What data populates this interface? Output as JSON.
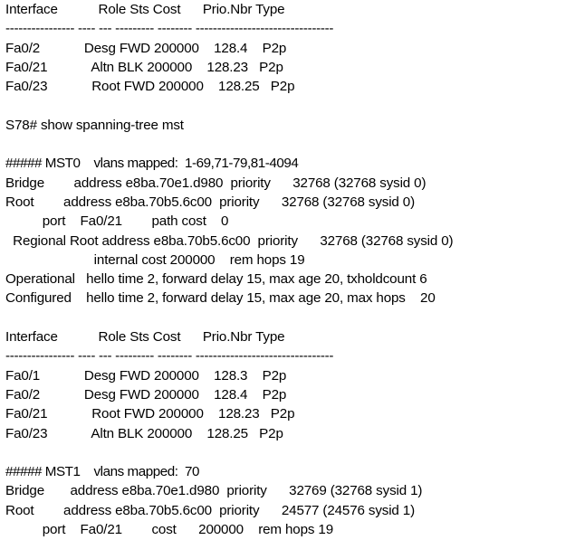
{
  "terminal": {
    "title": "Cisco IOS CLI output - show spanning-tree mst",
    "background_color": "#ffffff",
    "text_color": "#000000",
    "prompt": "S78#",
    "command": "show spanning-tree mst",
    "lines": [
      "Interface           Role Sts Cost      Prio.Nbr Type",
      "---------------- ---- --- --------- -------- --------------------------------",
      "Fa0/2            Desg FWD 200000    128.4    P2p",
      "Fa0/21            Altn BLK 200000    128.23   P2p",
      "Fa0/23            Root FWD 200000    128.25   P2p",
      "",
      "S78# show spanning-tree mst",
      "",
      "##### MST0    vlans mapped:  1-69,71-79,81-4094",
      "Bridge        address e8ba.70e1.d980  priority      32768 (32768 sysid 0)",
      "Root        address e8ba.70b5.6c00  priority      32768 (32768 sysid 0)",
      "          port    Fa0/21        path cost    0",
      "  Regional Root address e8ba.70b5.6c00  priority      32768 (32768 sysid 0)",
      "                        internal cost 200000    rem hops 19",
      "Operational   hello time 2, forward delay 15, max age 20, txholdcount 6",
      "Configured    hello time 2, forward delay 15, max age 20, max hops    20",
      "",
      "Interface           Role Sts Cost      Prio.Nbr Type",
      "---------------- ---- --- --------- -------- --------------------------------",
      "Fa0/1            Desg FWD 200000    128.3    P2p",
      "Fa0/2            Desg FWD 200000    128.4    P2p",
      "Fa0/21            Root FWD 200000    128.23   P2p",
      "Fa0/23            Altn BLK 200000    128.25   P2p",
      "",
      "##### MST1    vlans mapped:  70",
      "Bridge       address e8ba.70e1.d980  priority      32769 (32768 sysid 1)",
      "Root        address e8ba.70b5.6c00  priority      24577 (24576 sysid 1)",
      "          port    Fa0/21        cost      200000    rem hops 19"
    ],
    "mst0": {
      "header": "##### MST0    vlans mapped:  1-69,71-79,81-4094",
      "instance": "MST0",
      "vlans_mapped": "1-69,71-79,81-4094",
      "bridge_address": "e8ba.70e1.d980",
      "bridge_priority": "32768",
      "bridge_priority_detail": "(32768 sysid 0)",
      "root_address": "e8ba.70b5.6c00",
      "root_priority": "32768",
      "root_priority_detail": "(32768 sysid 0)",
      "root_port": "Fa0/21",
      "path_cost": "0",
      "regional_root_address": "e8ba.70b5.6c00",
      "regional_root_priority": "32768",
      "regional_root_priority_detail": "(32768 sysid 0)",
      "internal_cost": "200000",
      "rem_hops": "19",
      "operational": "hello time 2, forward delay 15, max age 20, txholdcount 6",
      "configured": "hello time 2, forward delay 15, max age 20, max hops    20"
    },
    "mst1": {
      "header": "##### MST1    vlans mapped:  70",
      "instance": "MST1",
      "vlans_mapped": "70",
      "bridge_address": "e8ba.70e1.d980",
      "bridge_priority": "32769",
      "bridge_priority_detail": "(32768 sysid 1)",
      "root_address": "e8ba.70b5.6c00",
      "root_priority": "24577",
      "root_priority_detail": "(24576 sysid 1)",
      "root_port": "Fa0/21",
      "cost": "200000",
      "rem_hops": "19"
    },
    "table_columns": [
      "Interface",
      "Role",
      "Sts",
      "Cost",
      "Prio.Nbr",
      "Type"
    ],
    "table1_rows": [
      {
        "interface": "Fa0/2",
        "role": "Desg",
        "sts": "FWD",
        "cost": "200000",
        "prio_nbr": "128.4",
        "type": "P2p"
      },
      {
        "interface": "Fa0/21",
        "role": "Altn",
        "sts": "BLK",
        "cost": "200000",
        "prio_nbr": "128.23",
        "type": "P2p"
      },
      {
        "interface": "Fa0/23",
        "role": "Root",
        "sts": "FWD",
        "cost": "200000",
        "prio_nbr": "128.25",
        "type": "P2p"
      }
    ],
    "table2_rows": [
      {
        "interface": "Fa0/1",
        "role": "Desg",
        "sts": "FWD",
        "cost": "200000",
        "prio_nbr": "128.3",
        "type": "P2p"
      },
      {
        "interface": "Fa0/2",
        "role": "Desg",
        "sts": "FWD",
        "cost": "200000",
        "prio_nbr": "128.4",
        "type": "P2p"
      },
      {
        "interface": "Fa0/21",
        "role": "Root",
        "sts": "FWD",
        "cost": "200000",
        "prio_nbr": "128.23",
        "type": "P2p"
      },
      {
        "interface": "Fa0/23",
        "role": "Altn",
        "sts": "BLK",
        "cost": "200000",
        "prio_nbr": "128.25",
        "type": "P2p"
      }
    ]
  }
}
